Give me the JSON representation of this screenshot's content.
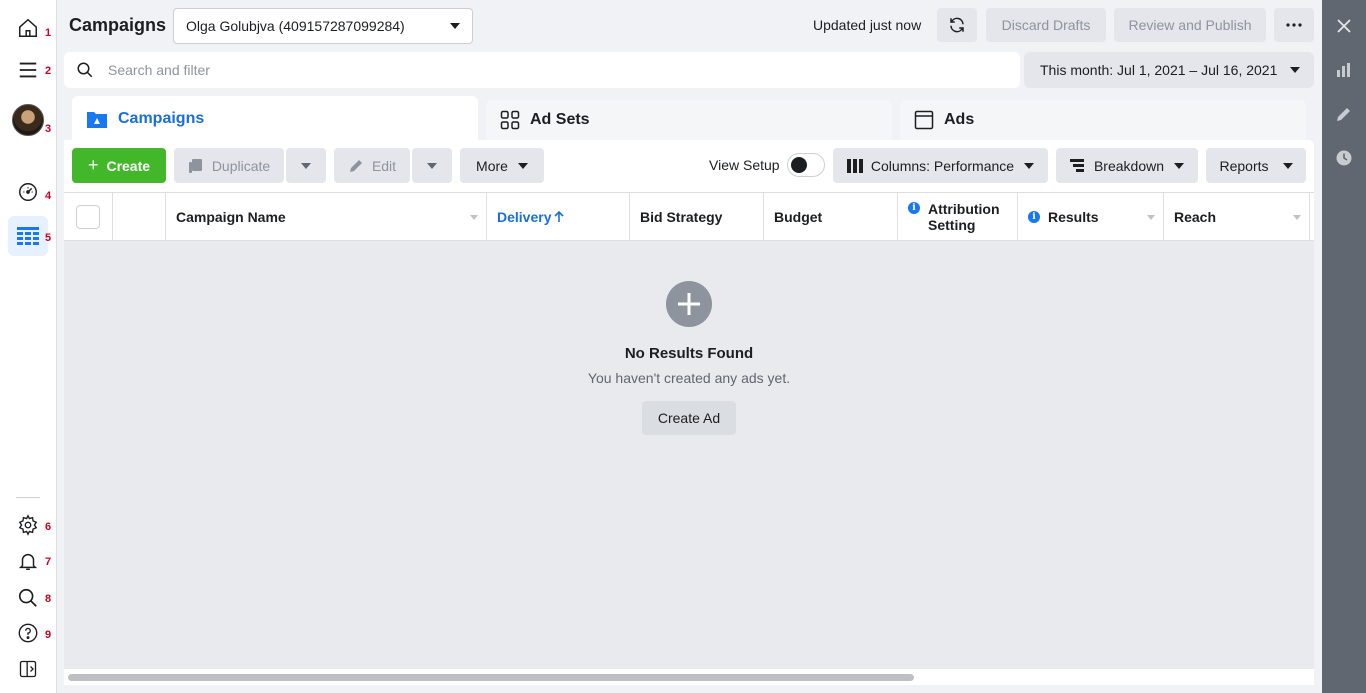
{
  "rail": {
    "items": [
      {
        "icon": "home-icon",
        "num": "1"
      },
      {
        "icon": "menu-icon",
        "num": "2"
      },
      {
        "icon": "avatar",
        "num": "3"
      },
      {
        "icon": "gauge-icon",
        "num": "4"
      },
      {
        "icon": "table-grid-icon",
        "num": "5"
      },
      {
        "icon": "gear-icon",
        "num": "6"
      },
      {
        "icon": "bell-icon",
        "num": "7"
      },
      {
        "icon": "search-icon",
        "num": "8"
      },
      {
        "icon": "help-icon",
        "num": "9"
      },
      {
        "icon": "panel-toggle-icon",
        "num": ""
      }
    ]
  },
  "header": {
    "title": "Campaigns",
    "account": "Olga Golubjva (409157287099284)",
    "updated": "Updated just now",
    "discard_label": "Discard Drafts",
    "review_label": "Review and Publish",
    "more_icon": "ellipsis-icon"
  },
  "search": {
    "placeholder": "Search and filter",
    "date_range": "This month: Jul 1, 2021 – Jul 16, 2021"
  },
  "tabs": [
    {
      "label": "Campaigns",
      "icon": "folder-icon",
      "active": true
    },
    {
      "label": "Ad Sets",
      "icon": "grid-squares-icon",
      "active": false
    },
    {
      "label": "Ads",
      "icon": "ad-window-icon",
      "active": false
    }
  ],
  "toolbar": {
    "create_label": "Create",
    "duplicate_label": "Duplicate",
    "edit_label": "Edit",
    "more_label": "More",
    "view_setup_label": "View Setup",
    "columns_label": "Columns: Performance",
    "breakdown_label": "Breakdown",
    "reports_label": "Reports"
  },
  "table": {
    "columns": [
      {
        "label": "Campaign Name"
      },
      {
        "label": "Delivery",
        "sorted": "asc"
      },
      {
        "label": "Bid Strategy"
      },
      {
        "label": "Budget"
      },
      {
        "label": "Attribution Setting",
        "info": true
      },
      {
        "label": "Results",
        "info": true
      },
      {
        "label": "Reach"
      }
    ]
  },
  "empty": {
    "title": "No Results Found",
    "subtitle": "You haven't created any ads yet.",
    "button": "Create Ad"
  },
  "colors": {
    "accent": "#1a6ed8",
    "create": "#42b72a",
    "right_panel": "#606770"
  }
}
